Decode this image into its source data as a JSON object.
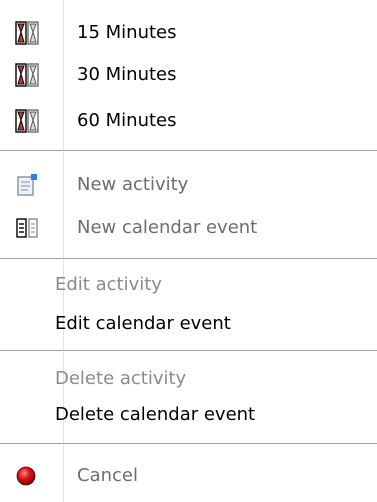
{
  "menu": {
    "items": [
      {
        "label": "15 Minutes",
        "icon": "hourglass-icon"
      },
      {
        "label": "30 Minutes",
        "icon": "hourglass-icon"
      },
      {
        "label": "60 Minutes",
        "icon": "hourglass-icon"
      },
      {
        "label": "New activity",
        "icon": "new-activity-icon"
      },
      {
        "label": "New calendar event",
        "icon": "new-calendar-event-icon"
      },
      {
        "label": "Edit activity"
      },
      {
        "label": "Edit calendar event"
      },
      {
        "label": "Delete activity"
      },
      {
        "label": "Delete calendar event"
      },
      {
        "label": "Cancel",
        "icon": "cancel-icon"
      }
    ]
  }
}
